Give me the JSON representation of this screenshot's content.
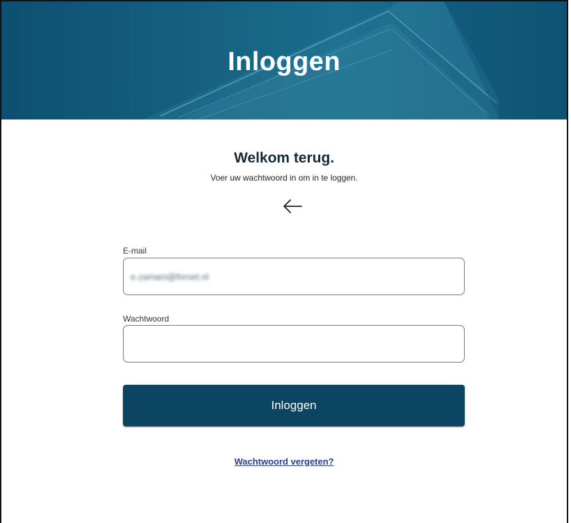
{
  "header": {
    "title": "Inloggen"
  },
  "welcome": {
    "heading": "Welkom terug.",
    "subtitle": "Voer uw wachtwoord in om in te loggen."
  },
  "icons": {
    "back": "arrow-left-icon"
  },
  "form": {
    "email_label": "E-mail",
    "email_value": "e.zamani@forset.nl",
    "password_label": "Wachtwoord",
    "password_value": "",
    "submit_label": "Inloggen"
  },
  "links": {
    "forgot_password": "Wachtwoord vergeten?"
  },
  "colors": {
    "hero": "#155f80",
    "button": "#0c4561",
    "heading": "#15293b",
    "link": "#2b3f93"
  }
}
